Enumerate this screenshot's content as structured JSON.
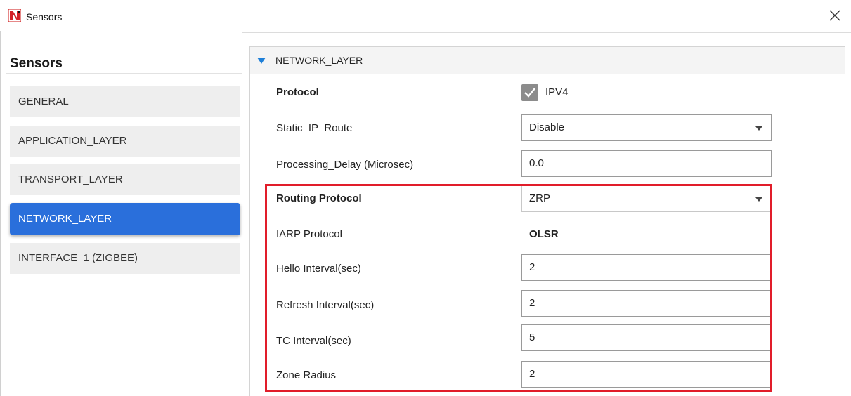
{
  "window": {
    "title": "Sensors",
    "close_icon": "close-icon"
  },
  "sidebar": {
    "title": "Sensors",
    "items": [
      {
        "label": "GENERAL",
        "active": false
      },
      {
        "label": "APPLICATION_LAYER",
        "active": false
      },
      {
        "label": "TRANSPORT_LAYER",
        "active": false
      },
      {
        "label": "NETWORK_LAYER",
        "active": true
      },
      {
        "label": "INTERFACE_1 (ZIGBEE)",
        "active": false
      }
    ]
  },
  "panel": {
    "title": "NETWORK_LAYER",
    "protocol": {
      "label": "Protocol",
      "checkbox_label": "IPV4",
      "checked": true
    },
    "static_ip_route": {
      "label": "Static_IP_Route",
      "value": "Disable"
    },
    "processing_delay": {
      "label": "Processing_Delay (Microsec)",
      "value": "0.0"
    },
    "routing_protocol": {
      "label": "Routing Protocol",
      "value": "ZRP"
    },
    "iarp_protocol": {
      "label": "IARP Protocol",
      "value": "OLSR"
    },
    "hello_interval": {
      "label": "Hello Interval(sec)",
      "value": "2"
    },
    "refresh_interval": {
      "label": "Refresh Interval(sec)",
      "value": "2"
    },
    "tc_interval": {
      "label": "TC Interval(sec)",
      "value": "5"
    },
    "zone_radius": {
      "label": "Zone Radius",
      "value": "2"
    }
  },
  "colors": {
    "accent": "#2a6fdb",
    "highlight": "#e11d2a",
    "triangle": "#1e7fd8"
  }
}
